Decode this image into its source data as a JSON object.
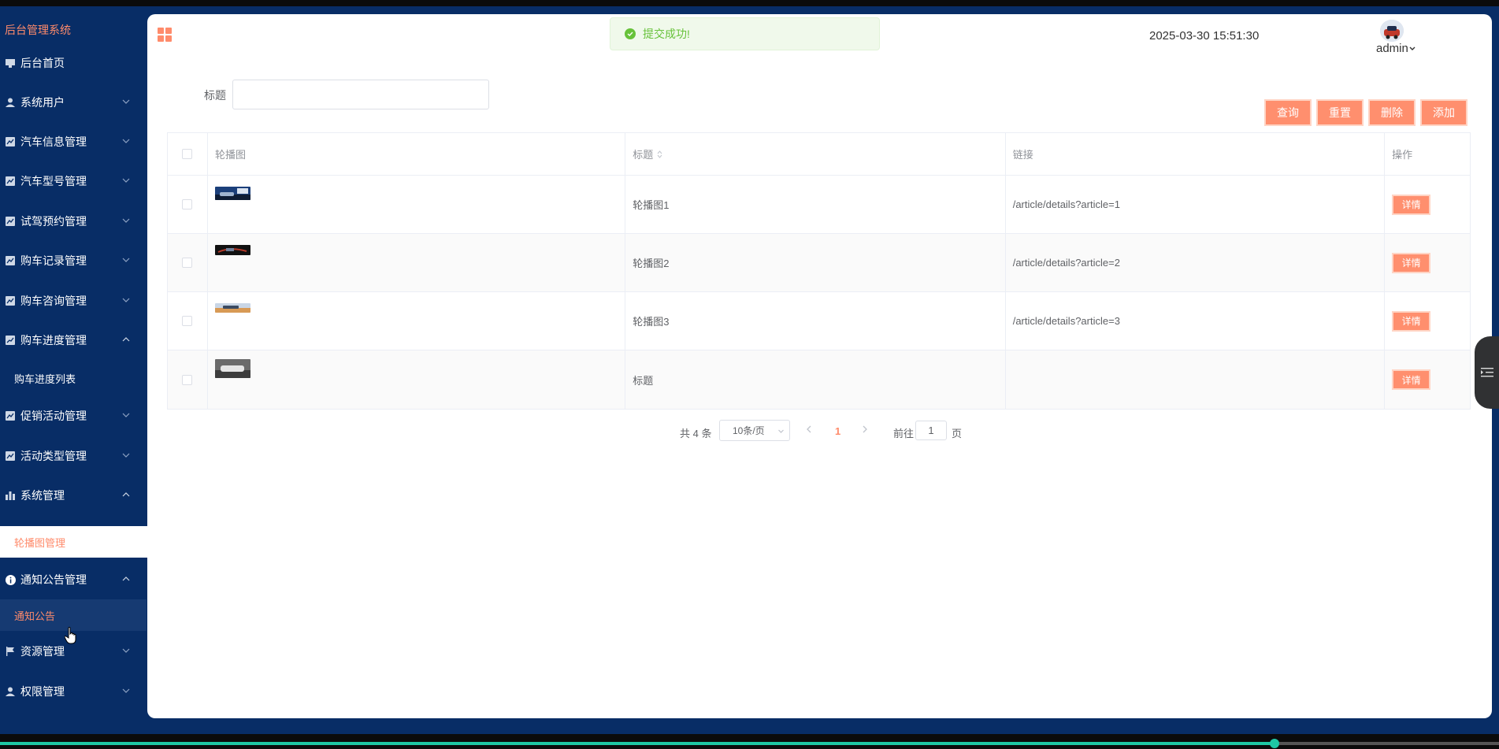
{
  "sidebar": {
    "brand": "后台管理系统",
    "items": [
      {
        "label": "后台首页",
        "icon": "monitor-icon"
      },
      {
        "label": "系统用户",
        "icon": "user-icon"
      },
      {
        "label": "汽车信息管理",
        "icon": "chart-check-icon"
      },
      {
        "label": "汽车型号管理",
        "icon": "chart-check-icon"
      },
      {
        "label": "试驾预约管理",
        "icon": "chart-check-icon"
      },
      {
        "label": "购车记录管理",
        "icon": "chart-check-icon"
      },
      {
        "label": "购车咨询管理",
        "icon": "chart-check-icon"
      },
      {
        "label": "购车进度管理",
        "icon": "trend-icon"
      },
      {
        "label": "购车进度列表"
      },
      {
        "label": "促销活动管理",
        "icon": "chart-check-icon"
      },
      {
        "label": "活动类型管理",
        "icon": "chart-check-icon"
      },
      {
        "label": "系统管理",
        "icon": "bar-chart-icon"
      },
      {
        "label": "轮播图管理"
      },
      {
        "label": "通知公告管理",
        "icon": "info-icon"
      },
      {
        "label": "通知公告"
      },
      {
        "label": "资源管理",
        "icon": "flag-icon"
      },
      {
        "label": "权限管理",
        "icon": "user-icon"
      }
    ]
  },
  "header": {
    "toast": "提交成功!",
    "datetime": "2025-03-30 15:51:30",
    "user": "admin"
  },
  "search": {
    "label": "标题",
    "value": "",
    "placeholder": ""
  },
  "toolbar": {
    "query": "查询",
    "reset": "重置",
    "delete": "删除",
    "add": "添加"
  },
  "table": {
    "columns": [
      "轮播图",
      "标题",
      "链接",
      "操作"
    ],
    "rows": [
      {
        "title": "轮播图1",
        "link": "/article/details?article=1",
        "action": "详情"
      },
      {
        "title": "轮播图2",
        "link": "/article/details?article=2",
        "action": "详情"
      },
      {
        "title": "轮播图3",
        "link": "/article/details?article=3",
        "action": "详情"
      },
      {
        "title": "标题",
        "link": "",
        "action": "详情"
      }
    ]
  },
  "pagination": {
    "total": "共 4 条",
    "page_size": "10条/页",
    "current": "1",
    "goto": "前往",
    "goto_value": "1",
    "page_suffix": "页"
  },
  "video_progress": 0.85,
  "colors": {
    "sidebar_bg": "#082d66",
    "accent": "#ff8b6b",
    "button": "#ff8f6e",
    "success": "#67c23a"
  }
}
